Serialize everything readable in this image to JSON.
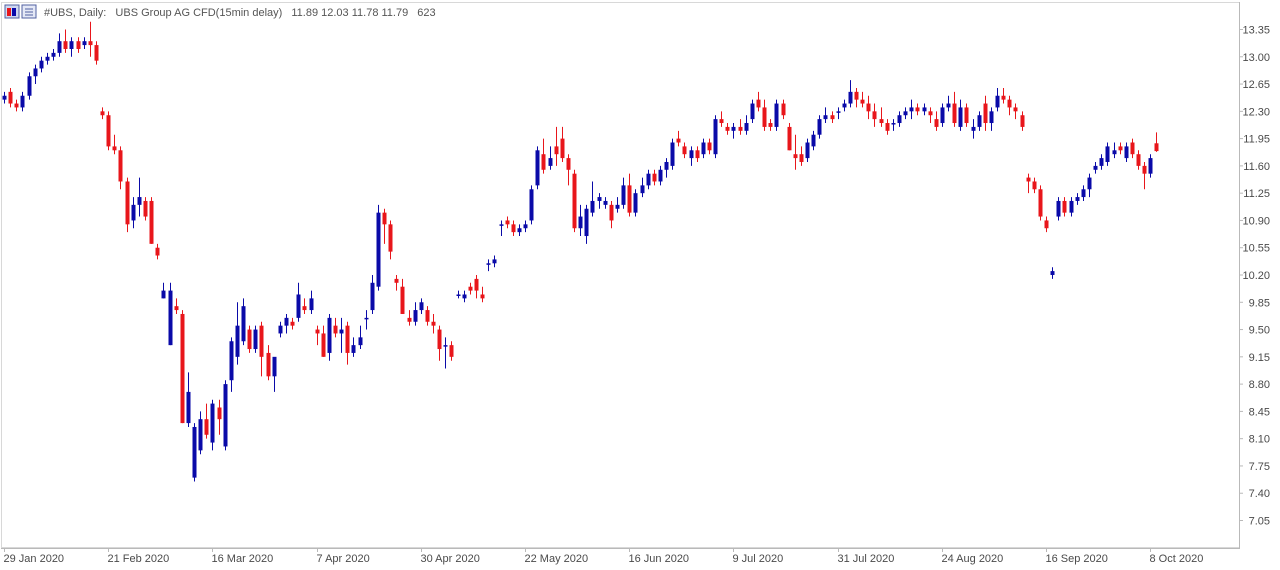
{
  "header": {
    "symbol_label": "#UBS, Daily:",
    "description": "UBS Group AG CFD(15min delay)",
    "ohlc": "11.89 12.03 11.78 11.79",
    "volume": "623"
  },
  "colors": {
    "bull": "#0a0aa8",
    "bear": "#e8161b",
    "axis": "#b9b9b9",
    "text": "#4a4a4a",
    "title": "#555555"
  },
  "icons": [
    "chart-window-icon",
    "chart-menu-icon"
  ],
  "chart_data": {
    "type": "candlestick",
    "title": "",
    "xlabel": "",
    "ylabel": "",
    "ylim": [
      6.9,
      13.5
    ],
    "grid": false,
    "y_ticks": [
      "13.35",
      "13.00",
      "12.65",
      "12.30",
      "11.95",
      "11.60",
      "11.25",
      "10.90",
      "10.55",
      "10.20",
      "9.85",
      "9.50",
      "9.15",
      "8.80",
      "8.45",
      "8.10",
      "7.75",
      "7.40",
      "7.05"
    ],
    "x_ticks": [
      {
        "label": "29 Jan 2020",
        "index": 0
      },
      {
        "label": "21 Feb 2020",
        "index": 17
      },
      {
        "label": "16 Mar 2020",
        "index": 34
      },
      {
        "label": "7 Apr 2020",
        "index": 51
      },
      {
        "label": "30 Apr 2020",
        "index": 68
      },
      {
        "label": "22 May 2020",
        "index": 85
      },
      {
        "label": "16 Jun 2020",
        "index": 102
      },
      {
        "label": "9 Jul 2020",
        "index": 119
      },
      {
        "label": "31 Jul 2020",
        "index": 136
      },
      {
        "label": "24 Aug 2020",
        "index": 153
      },
      {
        "label": "16 Sep 2020",
        "index": 170
      },
      {
        "label": "8 Oct 2020",
        "index": 187
      }
    ],
    "candles": [
      [
        12.45,
        12.55,
        12.4,
        12.5
      ],
      [
        12.55,
        12.6,
        12.35,
        12.4
      ],
      [
        12.4,
        12.45,
        12.3,
        12.35
      ],
      [
        12.35,
        12.55,
        12.3,
        12.5
      ],
      [
        12.5,
        12.8,
        12.45,
        12.75
      ],
      [
        12.75,
        12.9,
        12.65,
        12.85
      ],
      [
        12.85,
        13.0,
        12.8,
        12.95
      ],
      [
        12.95,
        13.05,
        12.9,
        13.0
      ],
      [
        13.0,
        13.1,
        12.95,
        13.05
      ],
      [
        13.05,
        13.3,
        13.0,
        13.2
      ],
      [
        13.2,
        13.35,
        13.05,
        13.1
      ],
      [
        13.1,
        13.25,
        13.0,
        13.2
      ],
      [
        13.2,
        13.25,
        13.05,
        13.1
      ],
      [
        13.15,
        13.25,
        13.1,
        13.2
      ],
      [
        13.2,
        13.45,
        13.0,
        13.15
      ],
      [
        13.15,
        13.2,
        12.9,
        12.95
      ],
      [
        12.3,
        12.35,
        12.2,
        12.25
      ],
      [
        12.25,
        12.3,
        11.8,
        11.85
      ],
      [
        11.85,
        12.0,
        11.75,
        11.8
      ],
      [
        11.8,
        11.85,
        11.3,
        11.4
      ],
      [
        11.4,
        11.45,
        10.75,
        10.85
      ],
      [
        10.9,
        11.2,
        10.8,
        11.1
      ],
      [
        11.1,
        11.45,
        10.95,
        11.2
      ],
      [
        11.15,
        11.2,
        10.9,
        10.95
      ],
      [
        11.15,
        11.2,
        10.6,
        10.6
      ],
      [
        10.55,
        10.6,
        10.4,
        10.45
      ],
      [
        9.9,
        10.1,
        9.9,
        10.0
      ],
      [
        9.3,
        10.1,
        9.3,
        10.0
      ],
      [
        9.8,
        9.9,
        9.7,
        9.75
      ],
      [
        9.7,
        9.75,
        8.3,
        8.3
      ],
      [
        8.3,
        8.95,
        8.25,
        8.7
      ],
      [
        7.6,
        8.3,
        7.55,
        8.25
      ],
      [
        7.95,
        8.45,
        7.9,
        8.35
      ],
      [
        8.35,
        8.55,
        8.1,
        8.15
      ],
      [
        8.05,
        8.6,
        7.95,
        8.55
      ],
      [
        8.5,
        8.6,
        8.15,
        8.35
      ],
      [
        8.0,
        8.85,
        7.95,
        8.8
      ],
      [
        8.85,
        9.4,
        8.7,
        9.35
      ],
      [
        9.15,
        9.85,
        9.05,
        9.55
      ],
      [
        9.35,
        9.9,
        9.3,
        9.8
      ],
      [
        9.5,
        9.55,
        9.2,
        9.25
      ],
      [
        9.25,
        9.55,
        9.2,
        9.5
      ],
      [
        9.55,
        9.6,
        8.9,
        9.15
      ],
      [
        9.2,
        9.3,
        8.85,
        8.9
      ],
      [
        8.9,
        9.1,
        8.7,
        9.15
      ],
      [
        9.45,
        9.6,
        9.4,
        9.55
      ],
      [
        9.55,
        9.7,
        9.45,
        9.65
      ],
      [
        9.6,
        9.65,
        9.5,
        9.55
      ],
      [
        9.65,
        10.1,
        9.6,
        9.95
      ],
      [
        9.8,
        9.9,
        9.7,
        9.75
      ],
      [
        9.75,
        10.0,
        9.7,
        9.9
      ],
      [
        9.5,
        9.55,
        9.3,
        9.45
      ],
      [
        9.45,
        9.55,
        9.15,
        9.15
      ],
      [
        9.2,
        9.7,
        9.1,
        9.65
      ],
      [
        9.55,
        9.65,
        9.4,
        9.45
      ],
      [
        9.45,
        9.65,
        9.2,
        9.5
      ],
      [
        9.55,
        9.6,
        9.05,
        9.2
      ],
      [
        9.2,
        9.4,
        9.15,
        9.3
      ],
      [
        9.3,
        9.55,
        9.25,
        9.4
      ],
      [
        9.65,
        9.75,
        9.5,
        9.65
      ],
      [
        9.75,
        10.2,
        9.7,
        10.1
      ],
      [
        10.05,
        11.1,
        10.0,
        11.0
      ],
      [
        11.0,
        11.05,
        10.6,
        10.85
      ],
      [
        10.85,
        10.9,
        10.4,
        10.5
      ],
      [
        10.15,
        10.2,
        10.0,
        10.1
      ],
      [
        10.05,
        10.15,
        9.7,
        9.7
      ],
      [
        9.65,
        9.75,
        9.55,
        9.6
      ],
      [
        9.6,
        9.85,
        9.55,
        9.75
      ],
      [
        9.75,
        9.9,
        9.7,
        9.85
      ],
      [
        9.75,
        9.8,
        9.55,
        9.6
      ],
      [
        9.6,
        9.7,
        9.45,
        9.55
      ],
      [
        9.5,
        9.55,
        9.1,
        9.25
      ],
      [
        9.3,
        9.4,
        9.0,
        9.3
      ],
      [
        9.3,
        9.35,
        9.1,
        9.15
      ],
      [
        9.95,
        10.0,
        9.9,
        9.95
      ],
      [
        9.9,
        10.0,
        9.85,
        9.95
      ],
      [
        10.05,
        10.1,
        9.95,
        10.0
      ],
      [
        10.15,
        10.2,
        9.9,
        10.0
      ],
      [
        9.95,
        10.05,
        9.85,
        9.9
      ],
      [
        10.35,
        10.4,
        10.25,
        10.35
      ],
      [
        10.35,
        10.45,
        10.3,
        10.4
      ],
      [
        10.85,
        10.9,
        10.7,
        10.85
      ],
      [
        10.9,
        10.95,
        10.8,
        10.85
      ],
      [
        10.85,
        10.9,
        10.7,
        10.75
      ],
      [
        10.75,
        10.85,
        10.7,
        10.8
      ],
      [
        10.8,
        10.9,
        10.75,
        10.85
      ],
      [
        10.9,
        11.35,
        10.85,
        11.3
      ],
      [
        11.35,
        11.85,
        11.3,
        11.8
      ],
      [
        11.75,
        11.95,
        11.5,
        11.55
      ],
      [
        11.6,
        11.85,
        11.55,
        11.7
      ],
      [
        11.85,
        12.1,
        11.6,
        11.75
      ],
      [
        11.95,
        12.1,
        11.65,
        11.7
      ],
      [
        11.7,
        11.75,
        11.35,
        11.55
      ],
      [
        11.5,
        11.55,
        10.75,
        10.8
      ],
      [
        10.8,
        11.1,
        10.7,
        10.95
      ],
      [
        10.7,
        11.1,
        10.6,
        11.05
      ],
      [
        11.0,
        11.4,
        10.95,
        11.15
      ],
      [
        11.15,
        11.25,
        11.05,
        11.2
      ],
      [
        11.1,
        11.2,
        11.05,
        11.15
      ],
      [
        11.1,
        11.15,
        10.8,
        10.9
      ],
      [
        11.05,
        11.2,
        11.0,
        11.1
      ],
      [
        11.1,
        11.45,
        11.05,
        11.35
      ],
      [
        11.35,
        11.5,
        10.95,
        11.0
      ],
      [
        11.0,
        11.3,
        10.95,
        11.25
      ],
      [
        11.25,
        11.45,
        11.2,
        11.35
      ],
      [
        11.35,
        11.55,
        11.3,
        11.5
      ],
      [
        11.5,
        11.55,
        11.35,
        11.4
      ],
      [
        11.4,
        11.6,
        11.35,
        11.55
      ],
      [
        11.55,
        11.7,
        11.45,
        11.65
      ],
      [
        11.6,
        11.95,
        11.55,
        11.9
      ],
      [
        11.95,
        12.05,
        11.85,
        11.9
      ],
      [
        11.85,
        11.9,
        11.7,
        11.75
      ],
      [
        11.7,
        11.85,
        11.6,
        11.8
      ],
      [
        11.8,
        11.85,
        11.65,
        11.7
      ],
      [
        11.75,
        11.95,
        11.7,
        11.9
      ],
      [
        11.9,
        11.95,
        11.75,
        11.8
      ],
      [
        11.75,
        12.25,
        11.7,
        12.2
      ],
      [
        12.2,
        12.3,
        12.1,
        12.15
      ],
      [
        12.1,
        12.15,
        12.0,
        12.05
      ],
      [
        12.05,
        12.15,
        11.95,
        12.1
      ],
      [
        12.1,
        12.2,
        12.0,
        12.05
      ],
      [
        12.05,
        12.25,
        12.0,
        12.15
      ],
      [
        12.2,
        12.45,
        12.15,
        12.4
      ],
      [
        12.45,
        12.55,
        12.3,
        12.35
      ],
      [
        12.35,
        12.45,
        12.05,
        12.1
      ],
      [
        12.15,
        12.2,
        12.05,
        12.1
      ],
      [
        12.1,
        12.45,
        12.05,
        12.4
      ],
      [
        12.4,
        12.45,
        12.2,
        12.25
      ],
      [
        12.1,
        12.15,
        11.8,
        11.8
      ],
      [
        11.75,
        12.0,
        11.55,
        11.7
      ],
      [
        11.75,
        11.85,
        11.6,
        11.65
      ],
      [
        11.7,
        11.95,
        11.65,
        11.9
      ],
      [
        11.85,
        12.05,
        11.8,
        12.0
      ],
      [
        12.0,
        12.25,
        11.95,
        12.2
      ],
      [
        12.2,
        12.35,
        12.15,
        12.25
      ],
      [
        12.25,
        12.3,
        12.15,
        12.2
      ],
      [
        12.3,
        12.35,
        12.2,
        12.3
      ],
      [
        12.35,
        12.45,
        12.3,
        12.4
      ],
      [
        12.4,
        12.7,
        12.35,
        12.55
      ],
      [
        12.55,
        12.6,
        12.35,
        12.45
      ],
      [
        12.45,
        12.55,
        12.35,
        12.4
      ],
      [
        12.4,
        12.5,
        12.2,
        12.3
      ],
      [
        12.3,
        12.4,
        12.1,
        12.2
      ],
      [
        12.2,
        12.35,
        12.1,
        12.15
      ],
      [
        12.15,
        12.2,
        12.0,
        12.05
      ],
      [
        12.15,
        12.2,
        12.05,
        12.15
      ],
      [
        12.15,
        12.3,
        12.1,
        12.25
      ],
      [
        12.25,
        12.35,
        12.2,
        12.3
      ],
      [
        12.3,
        12.45,
        12.2,
        12.35
      ],
      [
        12.35,
        12.4,
        12.25,
        12.3
      ],
      [
        12.3,
        12.4,
        12.25,
        12.35
      ],
      [
        12.3,
        12.35,
        12.15,
        12.25
      ],
      [
        12.2,
        12.3,
        12.05,
        12.1
      ],
      [
        12.15,
        12.4,
        12.1,
        12.35
      ],
      [
        12.35,
        12.5,
        12.3,
        12.4
      ],
      [
        12.4,
        12.55,
        12.1,
        12.15
      ],
      [
        12.1,
        12.45,
        12.05,
        12.35
      ],
      [
        12.35,
        12.4,
        12.1,
        12.15
      ],
      [
        12.05,
        12.2,
        11.95,
        12.1
      ],
      [
        12.1,
        12.3,
        12.05,
        12.25
      ],
      [
        12.4,
        12.5,
        12.05,
        12.15
      ],
      [
        12.15,
        12.35,
        12.05,
        12.3
      ],
      [
        12.35,
        12.6,
        12.3,
        12.5
      ],
      [
        12.5,
        12.6,
        12.4,
        12.45
      ],
      [
        12.45,
        12.5,
        12.25,
        12.35
      ],
      [
        12.35,
        12.4,
        12.2,
        12.3
      ],
      [
        12.25,
        12.3,
        12.05,
        12.1
      ],
      [
        11.45,
        11.5,
        11.25,
        11.4
      ],
      [
        11.4,
        11.45,
        11.25,
        11.3
      ],
      [
        11.3,
        11.35,
        10.9,
        10.95
      ],
      [
        10.9,
        10.95,
        10.75,
        10.8
      ],
      [
        10.2,
        10.3,
        10.15,
        10.25
      ],
      [
        10.95,
        11.2,
        10.9,
        11.15
      ],
      [
        11.15,
        11.2,
        10.95,
        11.0
      ],
      [
        11.0,
        11.2,
        10.95,
        11.15
      ],
      [
        11.15,
        11.25,
        11.1,
        11.2
      ],
      [
        11.2,
        11.35,
        11.15,
        11.3
      ],
      [
        11.3,
        11.5,
        11.2,
        11.45
      ],
      [
        11.55,
        11.65,
        11.5,
        11.6
      ],
      [
        11.6,
        11.75,
        11.55,
        11.7
      ],
      [
        11.65,
        11.9,
        11.6,
        11.85
      ],
      [
        11.75,
        11.9,
        11.7,
        11.8
      ],
      [
        11.85,
        11.9,
        11.75,
        11.8
      ],
      [
        11.7,
        11.9,
        11.65,
        11.85
      ],
      [
        11.9,
        11.95,
        11.7,
        11.75
      ],
      [
        11.75,
        11.8,
        11.55,
        11.6
      ],
      [
        11.6,
        11.65,
        11.3,
        11.5
      ],
      [
        11.5,
        11.75,
        11.45,
        11.7
      ],
      [
        11.89,
        12.03,
        11.78,
        11.79
      ]
    ]
  }
}
